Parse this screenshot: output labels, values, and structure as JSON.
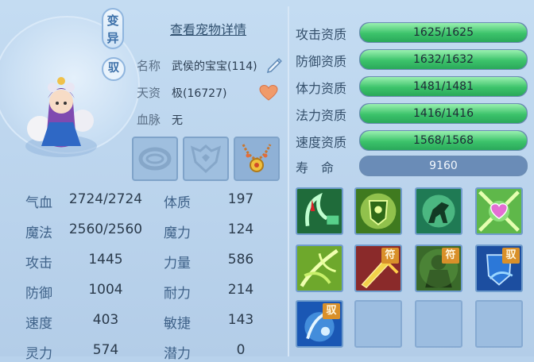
{
  "header": {
    "detail_link": "查看宠物详情",
    "tag_variant": "变异",
    "tag_tame": "驭"
  },
  "info": {
    "name_label": "名称",
    "name_value": "武侯的宝宝(114)",
    "aptitude_label": "天资",
    "aptitude_value": "极(16727)",
    "bloodline_label": "血脉",
    "bloodline_value": "无"
  },
  "stats": [
    {
      "label": "气血",
      "value": "2724/2724",
      "label2": "体质",
      "value2": "197"
    },
    {
      "label": "魔法",
      "value": "2560/2560",
      "label2": "魔力",
      "value2": "124"
    },
    {
      "label": "攻击",
      "value": "1445",
      "label2": "力量",
      "value2": "586"
    },
    {
      "label": "防御",
      "value": "1004",
      "label2": "耐力",
      "value2": "214"
    },
    {
      "label": "速度",
      "value": "403",
      "label2": "敏捷",
      "value2": "143"
    },
    {
      "label": "灵力",
      "value": "574",
      "label2": "潜力",
      "value2": "0"
    }
  ],
  "aptitudes": [
    {
      "label": "攻击资质",
      "text": "1625/1625",
      "fill": 1.0
    },
    {
      "label": "防御资质",
      "text": "1632/1632",
      "fill": 1.0
    },
    {
      "label": "体力资质",
      "text": "1481/1481",
      "fill": 1.0
    },
    {
      "label": "法力资质",
      "text": "1416/1416",
      "fill": 1.0
    },
    {
      "label": "速度资质",
      "text": "1568/1568",
      "fill": 1.0
    }
  ],
  "life": {
    "label": "寿　命",
    "value": "9160"
  },
  "skills": [
    {
      "name": "blood-drain-skill-icon",
      "badge": ""
    },
    {
      "name": "shield-crest-skill-icon",
      "badge": ""
    },
    {
      "name": "horse-skill-icon",
      "badge": ""
    },
    {
      "name": "heart-crystal-skill-icon",
      "badge": ""
    },
    {
      "name": "leaf-burst-skill-icon",
      "badge": ""
    },
    {
      "name": "sword-talisman-skill-icon",
      "badge": "符"
    },
    {
      "name": "giant-talisman-skill-icon",
      "badge": "符"
    },
    {
      "name": "water-shield-skill-icon",
      "badge": "驭"
    },
    {
      "name": "water-tame-skill-icon",
      "badge": "驭"
    }
  ],
  "colors": {
    "bar_fill": "#3cc36b",
    "bar_track": "#5f7fa6",
    "badge": "#d9902a",
    "panel_bg": "#b8d2ec"
  }
}
